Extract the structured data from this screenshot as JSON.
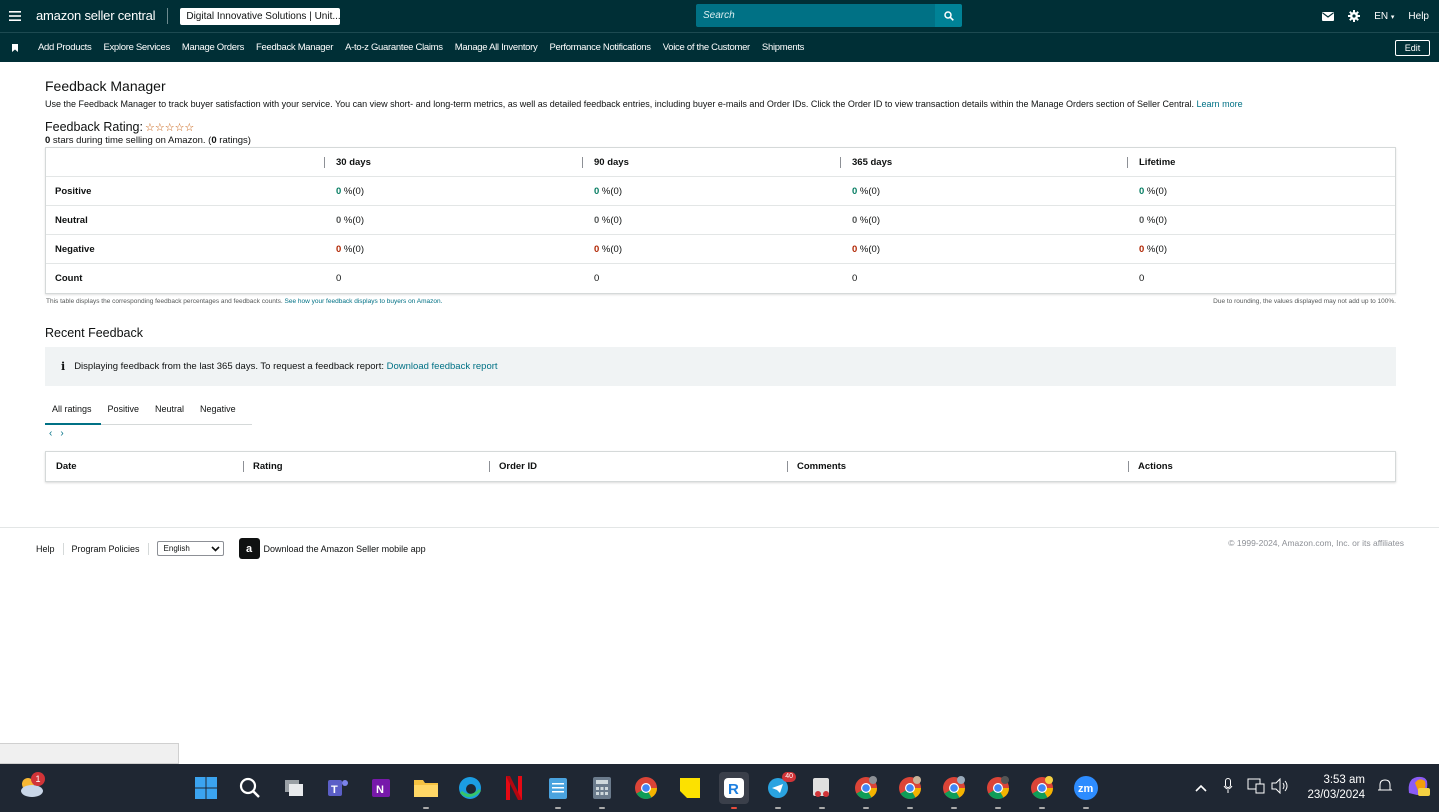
{
  "header": {
    "logo_text": "amazon seller central",
    "account": "Digital Innovative Solutions | Unit...",
    "search_placeholder": "Search",
    "language": "EN",
    "help": "Help"
  },
  "nav": {
    "items": [
      "Add Products",
      "Explore Services",
      "Manage Orders",
      "Feedback Manager",
      "A-to-z Guarantee Claims",
      "Manage All Inventory",
      "Performance Notifications",
      "Voice of the Customer",
      "Shipments"
    ],
    "edit": "Edit"
  },
  "page": {
    "title": "Feedback Manager",
    "description": "Use the Feedback Manager to track buyer satisfaction with your service. You can view short- and long-term metrics, as well as detailed feedback entries, including buyer e-mails and Order IDs. Click the Order ID to view transaction details within the Manage Orders section of Seller Central.",
    "learn_more": "Learn more",
    "rating_label": "Feedback Rating:",
    "rating_stars": "☆☆☆☆☆",
    "rating_value": "0",
    "rating_sub_mid": " stars during time selling on Amazon. (",
    "rating_count": "0",
    "rating_sub_end": " ratings)"
  },
  "feedback_table": {
    "headers": [
      "",
      "30 days",
      "90 days",
      "365 days",
      "Lifetime"
    ],
    "rows": [
      {
        "label": "Positive",
        "cells": [
          {
            "value": "0",
            "rest": " %(0)"
          },
          {
            "value": "0",
            "rest": " %(0)"
          },
          {
            "value": "0",
            "rest": " %(0)"
          },
          {
            "value": "0",
            "rest": " %(0)"
          }
        ]
      },
      {
        "label": "Neutral",
        "cells": [
          {
            "value": "0",
            "rest": " %(0)"
          },
          {
            "value": "0",
            "rest": " %(0)"
          },
          {
            "value": "0",
            "rest": " %(0)"
          },
          {
            "value": "0",
            "rest": " %(0)"
          }
        ]
      },
      {
        "label": "Negative",
        "cells": [
          {
            "value": "0",
            "rest": " %(0)"
          },
          {
            "value": "0",
            "rest": " %(0)"
          },
          {
            "value": "0",
            "rest": " %(0)"
          },
          {
            "value": "0",
            "rest": " %(0)"
          }
        ]
      },
      {
        "label": "Count",
        "cells": [
          {
            "value": "",
            "rest": "0"
          },
          {
            "value": "",
            "rest": "0"
          },
          {
            "value": "",
            "rest": "0"
          },
          {
            "value": "",
            "rest": "0"
          }
        ]
      }
    ],
    "colors": {
      "positive": "#067d62",
      "neutral": "#565959",
      "negative": "#b12704"
    },
    "note_left": "This table displays the corresponding feedback percentages and feedback counts.",
    "note_left_link": "See how your feedback displays to buyers on Amazon.",
    "note_right": "Due to rounding, the values displayed may not add up to 100%."
  },
  "recent": {
    "title": "Recent Feedback",
    "info_text": "Displaying feedback from the last 365 days. To request a feedback report:",
    "info_link": "Download feedback report",
    "tabs": [
      "All ratings",
      "Positive",
      "Neutral",
      "Negative"
    ],
    "columns": [
      "Date",
      "Rating",
      "Order ID",
      "Comments",
      "Actions"
    ]
  },
  "footer": {
    "help": "Help",
    "policies": "Program Policies",
    "language": "English",
    "app_text": "Download the Amazon Seller mobile app",
    "copyright": "© 1999-2024, Amazon.com, Inc. or its affiliates"
  },
  "taskbar": {
    "weather_badge": "1",
    "telegram_badge": "40",
    "time": "3:53 am",
    "date": "23/03/2024"
  }
}
